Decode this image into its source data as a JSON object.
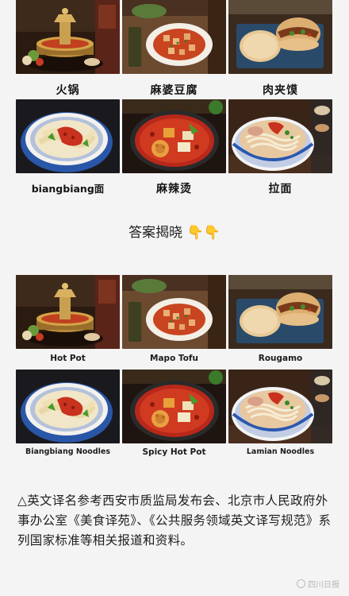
{
  "quiz": {
    "dishes": [
      {
        "name": "火锅",
        "icon": "hot-pot-photo"
      },
      {
        "name": "麻婆豆腐",
        "icon": "mapo-tofu-photo"
      },
      {
        "name": "肉夹馍",
        "icon": "rougamo-photo"
      },
      {
        "name": "biangbiang面",
        "icon": "biangbiang-noodles-photo"
      },
      {
        "name": "麻辣烫",
        "icon": "spicy-hot-pot-photo"
      },
      {
        "name": "拉面",
        "icon": "lamian-noodles-photo"
      }
    ]
  },
  "reveal": {
    "text": "答案揭晓",
    "emoji": "👇👇"
  },
  "answers": {
    "dishes": [
      {
        "name": "Hot Pot"
      },
      {
        "name": "Mapo Tofu"
      },
      {
        "name": "Rougamo"
      },
      {
        "name": "Biangbiang Noodles"
      },
      {
        "name": "Spicy Hot Pot"
      },
      {
        "name": "Lamian Noodles"
      }
    ]
  },
  "note": {
    "text": "△英文译名参考西安市质监局发布会、北京市人民政府外事办公室《美食译苑》、《公共服务领域英文译写规范》系列国家标准等相关报道和资料。"
  },
  "watermark": {
    "text": "四川日报"
  },
  "colors": {
    "background": "#f4f4f4",
    "chili_red": "#c8321e",
    "bowl_blue": "#2f56a8",
    "wood_dark": "#3a2516"
  }
}
